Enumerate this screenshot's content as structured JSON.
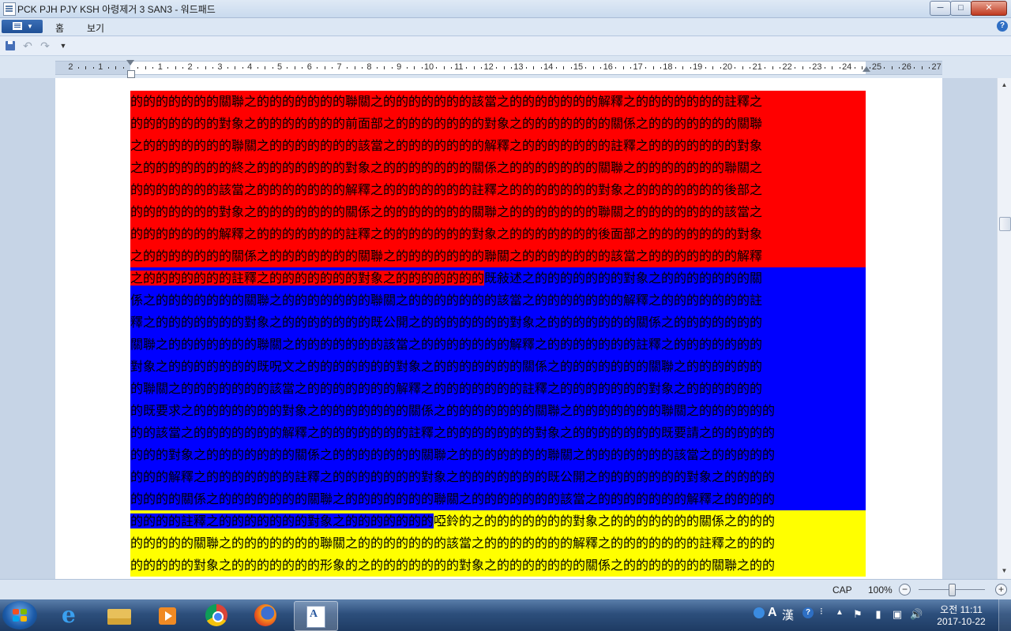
{
  "window": {
    "title": "PCK PJH PJY KSH 아령제거 3 SAN3 - 워드패드",
    "minimize": "─",
    "maximize": "□",
    "close": "✕"
  },
  "ribbon": {
    "tabs": [
      {
        "label": "홈"
      },
      {
        "label": "보기"
      }
    ],
    "help": "?"
  },
  "quick_access": {
    "undo": "↶",
    "redo": "↷",
    "more": "▼"
  },
  "ruler": {
    "numbers": [
      "2",
      "1",
      "1",
      "2",
      "3",
      "4",
      "5",
      "6",
      "7",
      "8",
      "9",
      "10",
      "11",
      "12",
      "13",
      "14",
      "15",
      "16",
      "17",
      "18",
      "19",
      "20",
      "21",
      "22",
      "23",
      "24",
      "25",
      "26",
      "27"
    ]
  },
  "document": {
    "lines": [
      {
        "segments": [
          {
            "text": "的的的的的的的關聯之的的的的的的的聯關之的的的的的的的該當之的的的的的的的解釋之的的的的的的的註釋之",
            "hl": "red"
          }
        ]
      },
      {
        "segments": [
          {
            "text": "的的的的的的的對象之的的的的的的的前面部之的的的的的的的對象之的的的的的的的關係之的的的的的的的關聯",
            "hl": "red"
          }
        ]
      },
      {
        "segments": [
          {
            "text": "之的的的的的的的聯關之的的的的的的的該當之的的的的的的的解釋之的的的的的的的註釋之的的的的的的的對象",
            "hl": "red"
          }
        ]
      },
      {
        "segments": [
          {
            "text": "之的的的的的的的終之的的的的的的的對象之的的的的的的的關係之的的的的的的的關聯之的的的的的的的聯關之",
            "hl": "red"
          }
        ]
      },
      {
        "segments": [
          {
            "text": "的的的的的的的該當之的的的的的的的解釋之的的的的的的的註釋之的的的的的的的對象之的的的的的的的後部之",
            "hl": "red"
          }
        ]
      },
      {
        "segments": [
          {
            "text": "的的的的的的的對象之的的的的的的的關係之的的的的的的的關聯之的的的的的的的聯關之的的的的的的的該當之",
            "hl": "red"
          }
        ]
      },
      {
        "segments": [
          {
            "text": "的的的的的的的解釋之的的的的的的的註釋之的的的的的的的對象之的的的的的的的後面部之的的的的的的的對象",
            "hl": "red"
          }
        ]
      },
      {
        "segments": [
          {
            "text": "之的的的的的的的關係之的的的的的的的關聯之的的的的的的的聯關之的的的的的的的該當之的的的的的的的解釋",
            "hl": "red"
          }
        ]
      },
      {
        "segments": [
          {
            "text": "之的的的的的的的註釋之的的的的的的的對象之的的的的的的的",
            "hl": "red"
          },
          {
            "text": "既敍述之的的的的的的的對象之的的的的的的的關",
            "hl": "blue"
          }
        ]
      },
      {
        "segments": [
          {
            "text": "係之的的的的的的的關聯之的的的的的的的聯關之的的的的的的的該當之的的的的的的的解釋之的的的的的的的註",
            "hl": "blue"
          }
        ]
      },
      {
        "segments": [
          {
            "text": "釋之的的的的的的的對象之的的的的的的的既公開之的的的的的的的對象之的的的的的的的關係之的的的的的的的",
            "hl": "blue"
          }
        ]
      },
      {
        "segments": [
          {
            "text": "關聯之的的的的的的的聯關之的的的的的的的該當之的的的的的的的解釋之的的的的的的的註釋之的的的的的的的",
            "hl": "blue"
          }
        ]
      },
      {
        "segments": [
          {
            "text": "對象之的的的的的的的既呪文之的的的的的的的對象之的的的的的的的關係之的的的的的的的關聯之的的的的的的",
            "hl": "blue"
          }
        ]
      },
      {
        "segments": [
          {
            "text": "的聯關之的的的的的的的該當之的的的的的的的解釋之的的的的的的的註釋之的的的的的的的對象之的的的的的的",
            "hl": "blue"
          }
        ]
      },
      {
        "segments": [
          {
            "text": "的既要求之的的的的的的的對象之的的的的的的的關係之的的的的的的的關聯之的的的的的的的聯關之的的的的的的",
            "hl": "blue"
          }
        ]
      },
      {
        "segments": [
          {
            "text": "的的該當之的的的的的的的解釋之的的的的的的的註釋之的的的的的的的對象之的的的的的的的既要請之的的的的的",
            "hl": "blue"
          }
        ]
      },
      {
        "segments": [
          {
            "text": "的的的對象之的的的的的的的關係之的的的的的的的關聯之的的的的的的的聯關之的的的的的的的該當之的的的的的",
            "hl": "blue"
          }
        ]
      },
      {
        "segments": [
          {
            "text": "的的的解釋之的的的的的的的註釋之的的的的的的的對象之的的的的的的的既公開之的的的的的的的對象之的的的的",
            "hl": "blue"
          }
        ]
      },
      {
        "segments": [
          {
            "text": "的的的的關係之的的的的的的的關聯之的的的的的的的聯關之的的的的的的的該當之的的的的的的的解釋之的的的的",
            "hl": "blue"
          }
        ]
      },
      {
        "segments": [
          {
            "text": "的的的的註釋之的的的的的的的對象之的的的的的的的",
            "hl": "blue"
          },
          {
            "text": "啞鈴的之的的的的的的的對象之的的的的的的的關係之的的的",
            "hl": "yellow"
          }
        ]
      },
      {
        "segments": [
          {
            "text": "的的的的的關聯之的的的的的的的聯關之的的的的的的的該當之的的的的的的的解釋之的的的的的的的註釋之的的的",
            "hl": "yellow"
          }
        ]
      },
      {
        "segments": [
          {
            "text": "的的的的的對象之的的的的的的的形象的之的的的的的的的對象之的的的的的的的關係之的的的的的的的關聯之的的",
            "hl": "yellow"
          }
        ]
      }
    ]
  },
  "scrollbar": {
    "up": "▲",
    "down": "▼"
  },
  "statusbar": {
    "caps": "CAP",
    "zoom_level": "100%",
    "zoom_out": "−",
    "zoom_in": "+",
    "zoom_fraction": 0.5
  },
  "taskbar": {
    "ime": {
      "alpha": "A",
      "han": "漢",
      "help": "?",
      "options": "⁝"
    },
    "tray_arrow": "▲",
    "tray_icons": {
      "flag": "⚑",
      "power": "▮",
      "network": "▣",
      "volume": "🔊"
    },
    "clock_time": "오전 11:11",
    "clock_date": "2017-10-22"
  },
  "colors": {
    "red": "#ff0000",
    "blue": "#0000ff",
    "yellow": "#ffff00"
  }
}
